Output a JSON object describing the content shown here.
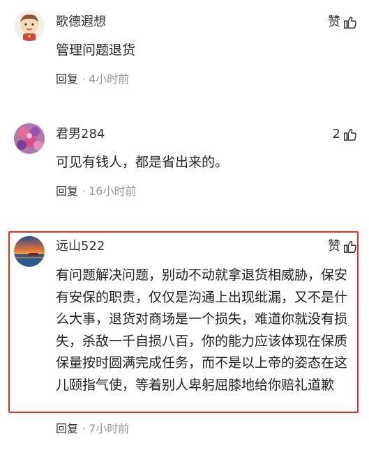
{
  "comments": [
    {
      "username": "歌德遐想",
      "like_label": "赞",
      "text": "管理问题退货",
      "reply_label": "回复",
      "separator": "·",
      "time": "4小时前"
    },
    {
      "username": "君男284",
      "like_label": "2",
      "text": "可见有钱人，都是省出来的。",
      "reply_label": "回复",
      "separator": "·",
      "time": "16小时前"
    },
    {
      "username": "远山522",
      "like_label": "赞",
      "text": "有问题解决问题，别动不动就拿退货相威胁，保安有安保的职责，仅仅是沟通上出现纰漏，又不是什么大事，退货对商场是一个损失，难道你就没有损失，杀敌一千自损八百，你的能力应该体现在保质保量按时圆满完成任务，而不是以上帝的姿态在这儿颐指气使，等着别人卑躬屈膝地给你赔礼道歉",
      "reply_label": "回复",
      "separator": "·",
      "time": "7小时前"
    }
  ],
  "colors": {
    "highlight_border": "#d9302c",
    "meta_gray": "#999999",
    "text": "#222222"
  }
}
